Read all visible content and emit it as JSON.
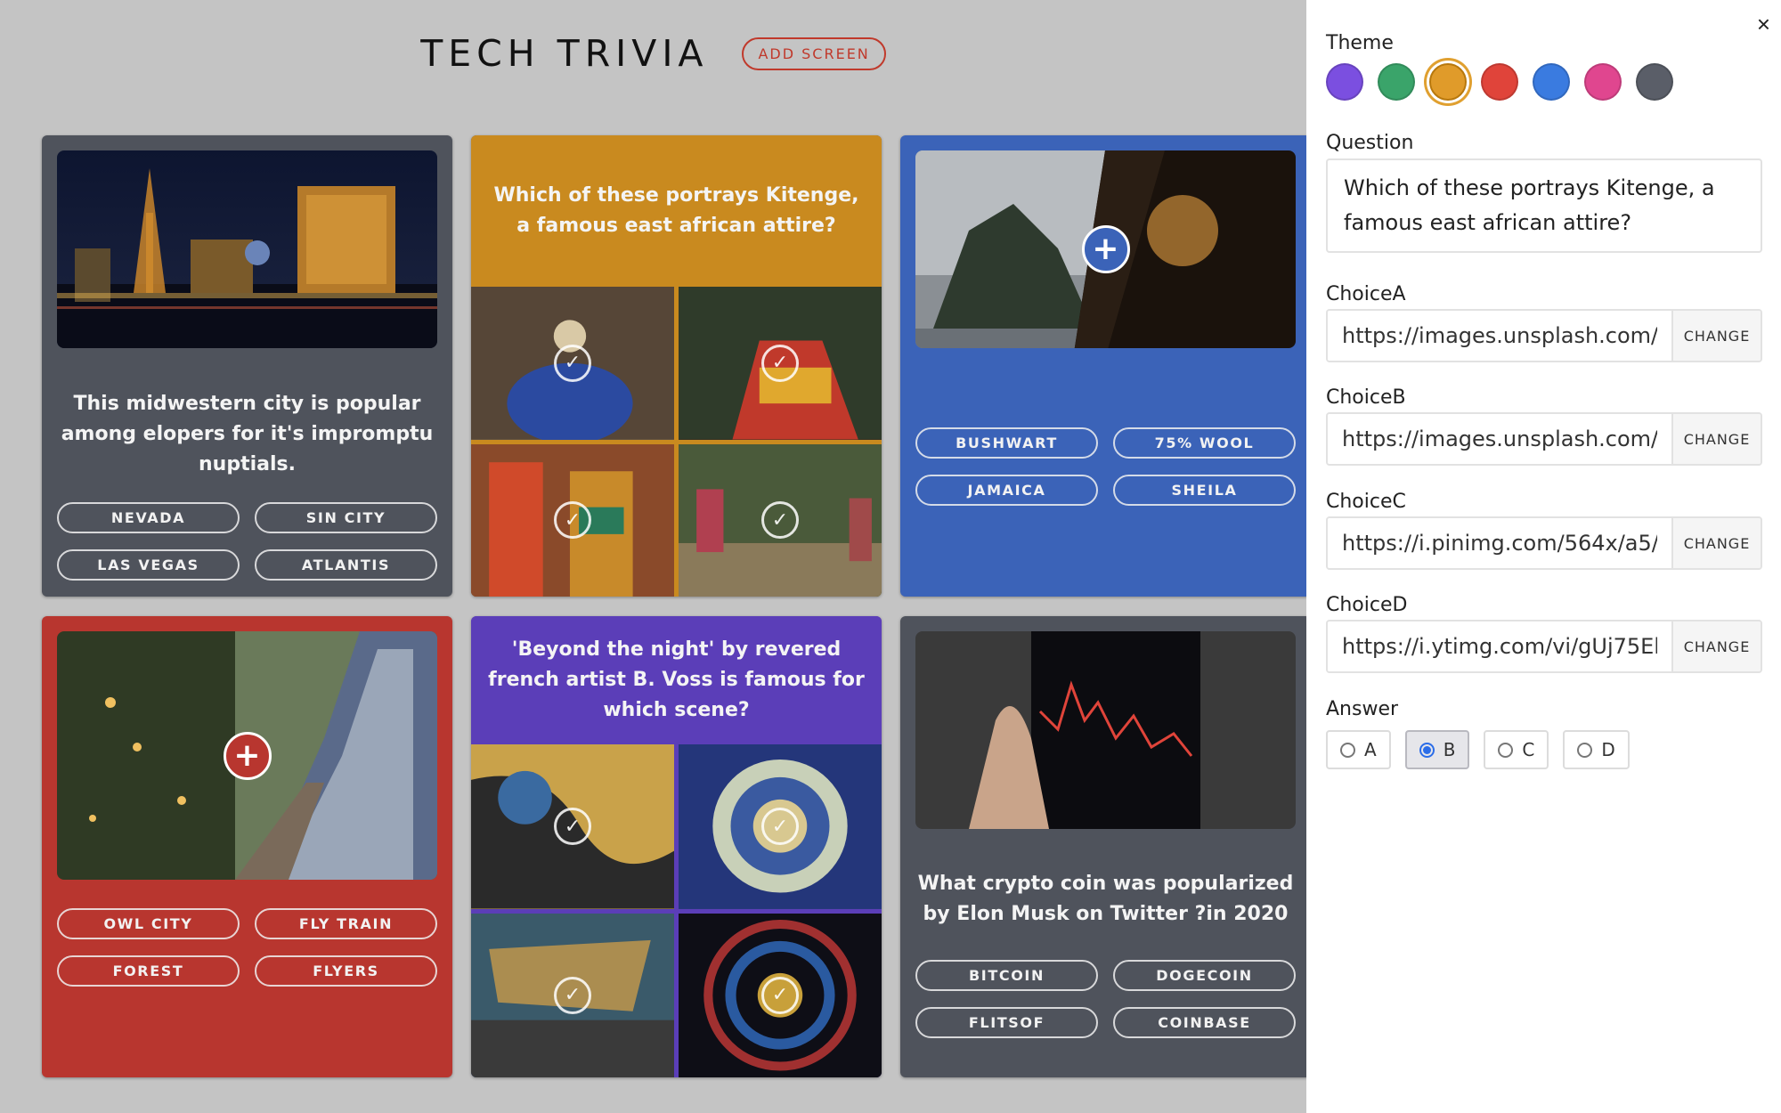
{
  "app": {
    "title": "TECH TRIVIA",
    "add_screen_label": "ADD SCREEN"
  },
  "cards": [
    {
      "id": "vegas",
      "theme": "#4f535c",
      "question": "This midwestern city is popular among elopers for it's impromptu nuptials.",
      "choices": [
        "NEVADA",
        "SIN CITY",
        "LAS VEGAS",
        "ATLANTIS"
      ]
    },
    {
      "id": "kitenge",
      "theme": "#c98a1f",
      "question": "Which of these portrays Kitenge, a famous east african attire?",
      "image_choices": 4
    },
    {
      "id": "blue-photo",
      "theme": "#3b63b8",
      "question": "",
      "choices": [
        "BUSHWART",
        "75% WOOL",
        "JAMAICA",
        "SHEILA"
      ]
    },
    {
      "id": "train",
      "theme": "#b8362f",
      "question": "",
      "choices": [
        "OWL CITY",
        "FLY TRAIN",
        "FOREST",
        "FLYERS"
      ]
    },
    {
      "id": "voss",
      "theme": "#5b3eb8",
      "question": "'Beyond the night' by revered french artist B. Voss is famous for which scene?",
      "image_choices": 4
    },
    {
      "id": "crypto",
      "theme": "#4f535c",
      "question": "What crypto coin was popularized by Elon Musk on Twitter ?in 2020",
      "choices": [
        "BITCOIN",
        "DOGECOIN",
        "FLITSOF",
        "COINBASE"
      ]
    }
  ],
  "panel": {
    "theme_label": "Theme",
    "theme_colors": [
      "#7b4fe0",
      "#3aa46a",
      "#e09b2a",
      "#e0443a",
      "#3a7be0",
      "#e0468f",
      "#5a5e68"
    ],
    "selected_theme": "#e09b2a",
    "question_label": "Question",
    "question_value": "Which of these portrays Kitenge, a famous east african attire?",
    "choiceA_label": "ChoiceA",
    "choiceA_value": "https://images.unsplash.com/photo-1",
    "choiceB_label": "ChoiceB",
    "choiceB_value": "https://images.unsplash.com/photo-1",
    "choiceC_label": "ChoiceC",
    "choiceC_value": "https://i.pinimg.com/564x/a5/2d/1",
    "choiceD_label": "ChoiceD",
    "choiceD_value": "https://i.ytimg.com/vi/gUj75EhX0u",
    "change_label": "CHANGE",
    "answer_label": "Answer",
    "answers": [
      "A",
      "B",
      "C",
      "D"
    ],
    "selected_answer": "B",
    "close_icon": "×"
  }
}
